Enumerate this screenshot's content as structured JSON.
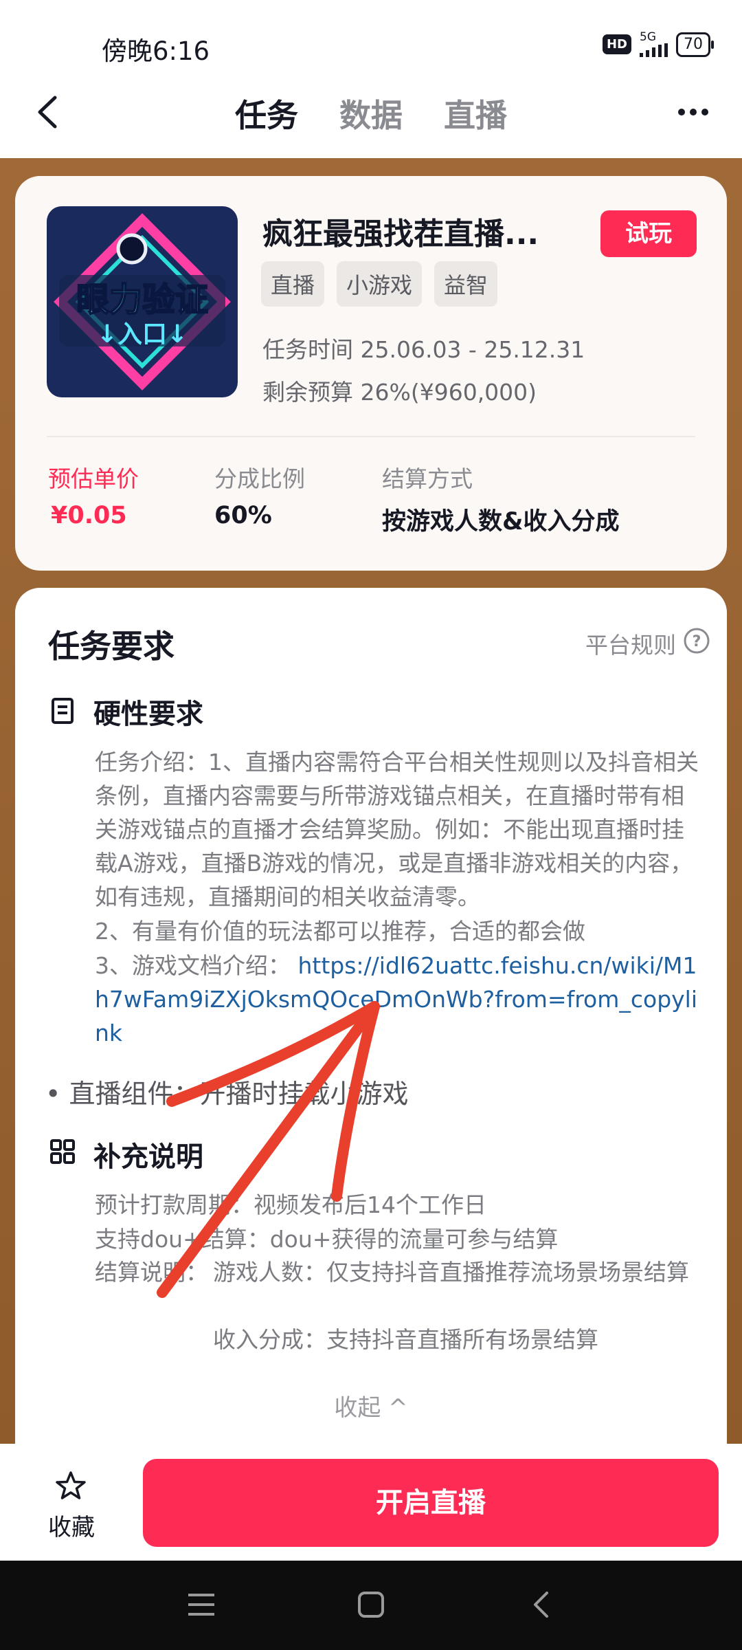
{
  "status_bar": {
    "time": "傍晚6:16",
    "hd": "HD",
    "network": "5G",
    "battery": "70"
  },
  "header": {
    "tabs": [
      {
        "label": "任务",
        "active": true
      },
      {
        "label": "数据",
        "active": false
      },
      {
        "label": "直播",
        "active": false
      }
    ]
  },
  "game": {
    "icon_text_line1": "眼力验证",
    "icon_text_line2": "↓入口↓",
    "title": "疯狂最强找茬直播...",
    "try_label": "试玩",
    "tags": [
      "直播",
      "小游戏",
      "益智"
    ],
    "task_time": "任务时间 25.06.03 - 25.12.31",
    "budget": "剩余预算 26%(¥960,000)"
  },
  "stats": [
    {
      "label": "预估单价",
      "value": "¥0.05"
    },
    {
      "label": "分成比例",
      "value": "60%"
    },
    {
      "label": "结算方式",
      "value": "按游戏人数&收入分成"
    }
  ],
  "requirements": {
    "title": "任务要求",
    "rules_link": "平台规则",
    "hard_title": "硬性要求",
    "intro": "任务介绍：1、直播内容需符合平台相关性规则以及抖音相关条例，直播内容需要与所带游戏锚点相关，在直播时带有相关游戏锚点的直播才会结算奖励。例如：不能出现直播时挂载A游戏，直播B游戏的情况，或是直播非游戏相关的内容，如有违规，直播期间的相关收益清零。",
    "point2": "2、有量有价值的玩法都可以推荐，合适的都会做",
    "point3_label": "3、游戏文档介绍：",
    "point3_link": "https://idl62uattc.feishu.cn/wiki/M1h7wFam9iZXjOksmQOceDmOnWb?from=from_copylink",
    "component": "• 直播组件：开播时挂载小游戏",
    "extra_title": "补充说明",
    "extra_lines": [
      {
        "label": "预计打款周期：",
        "value": "视频发布后14个工作日"
      },
      {
        "label": "支持dou+结算：",
        "value": "dou+获得的流量可参与结算"
      },
      {
        "label": "结算说明：",
        "value": "游戏人数：仅支持抖音直播推荐流场景场景结算"
      },
      {
        "label": "",
        "value": "收入分成：支持抖音直播所有场景结算"
      }
    ],
    "collapse": "收起 ^"
  },
  "bottom": {
    "fav_label": "收藏",
    "live_button": "开启直播"
  },
  "colors": {
    "accent": "#fe2c55",
    "link": "#1e5fa0",
    "annotation_arrow": "#e8402c"
  }
}
